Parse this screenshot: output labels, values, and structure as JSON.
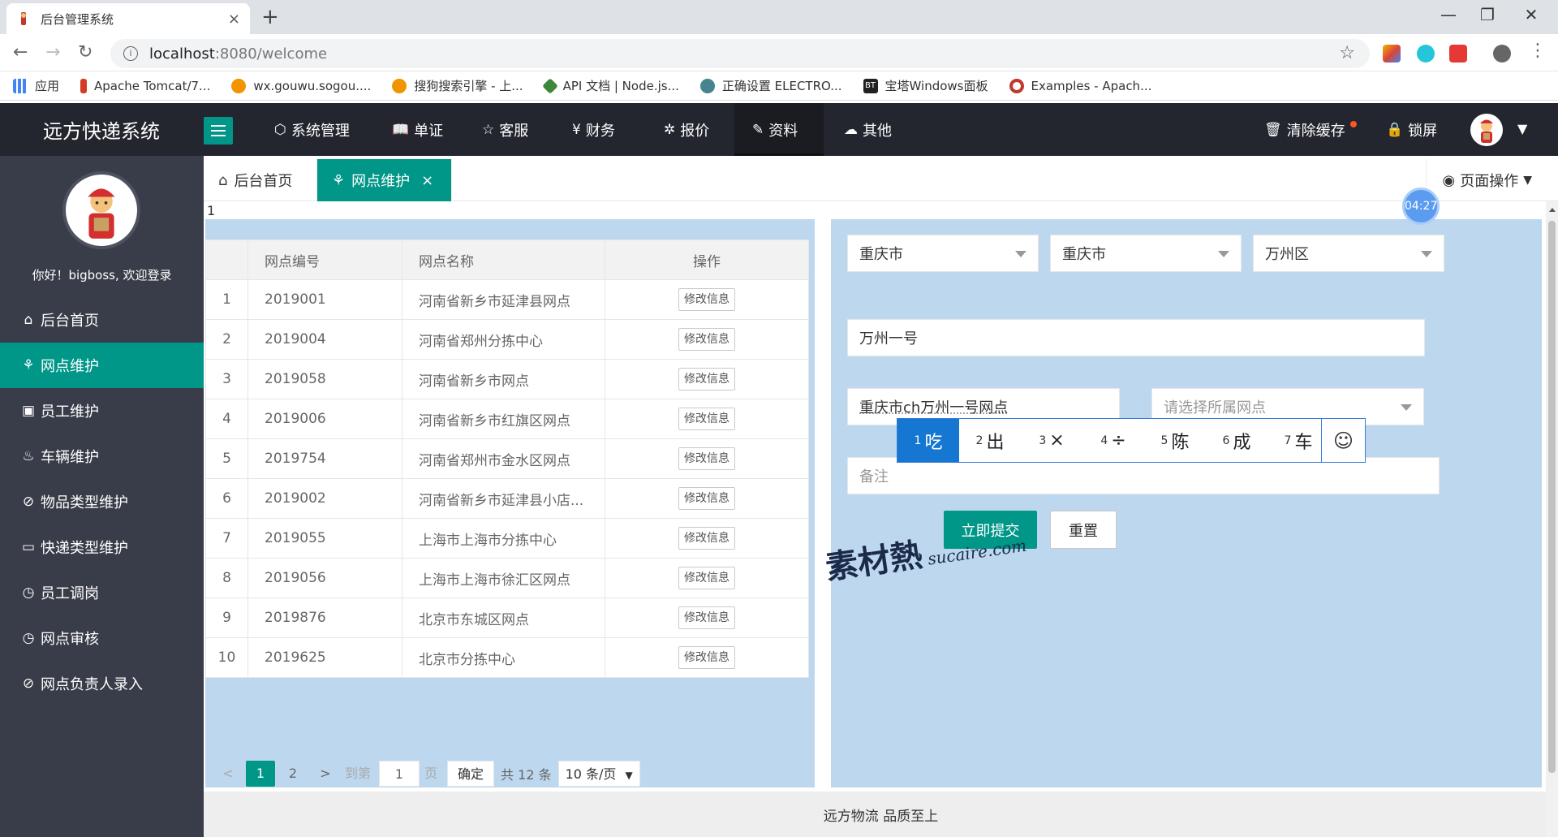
{
  "browser": {
    "tab_title": "后台管理系统",
    "tab_close": "×",
    "new_tab": "+",
    "url_host": "localhost",
    "url_path": ":8080/welcome",
    "window_controls": [
      "—",
      "❐",
      "✕"
    ]
  },
  "bookmarks": [
    {
      "label": "应用",
      "color": "#4285f4"
    },
    {
      "label": "Apache Tomcat/7...",
      "color": "#d33b27"
    },
    {
      "label": "wx.gouwu.sogou....",
      "color": "#f29400"
    },
    {
      "label": "搜狗搜索引擎 - 上...",
      "color": "#f29400"
    },
    {
      "label": "API 文档 | Node.js...",
      "color": "#3c873a"
    },
    {
      "label": "正确设置 ELECTRO...",
      "color": "#47848f"
    },
    {
      "label": "宝塔Windows面板",
      "color": "#222222"
    },
    {
      "label": "Examples - Apach...",
      "color": "#c0392b"
    }
  ],
  "header": {
    "logo": "远方快递系统",
    "nav": [
      {
        "label": "系统管理",
        "icon": "cube-icon"
      },
      {
        "label": "单证",
        "icon": "book-icon"
      },
      {
        "label": "客服",
        "icon": "star-icon"
      },
      {
        "label": "财务",
        "icon": "yen-icon"
      },
      {
        "label": "报价",
        "icon": "fan-icon"
      },
      {
        "label": "资料",
        "icon": "edit-icon"
      },
      {
        "label": "其他",
        "icon": "cloud-upload-icon"
      }
    ],
    "active_nav": "资料",
    "clear_cache": "清除缓存",
    "lock_screen": "锁屏"
  },
  "sidebar": {
    "greeting": "你好！bigboss, 欢迎登录",
    "items": [
      {
        "label": "后台首页",
        "icon": "home-icon"
      },
      {
        "label": "网点维护",
        "icon": "network-icon"
      },
      {
        "label": "员工维护",
        "icon": "id-card-icon"
      },
      {
        "label": "车辆维护",
        "icon": "car-icon"
      },
      {
        "label": "物品类型维护",
        "icon": "code-icon"
      },
      {
        "label": "快递类型维护",
        "icon": "monitor-icon"
      },
      {
        "label": "员工调岗",
        "icon": "clock-icon"
      },
      {
        "label": "网点审核",
        "icon": "clock-icon"
      },
      {
        "label": "网点负责人录入",
        "icon": "code-icon"
      }
    ],
    "active_index": 1
  },
  "tabs": {
    "home": "后台首页",
    "current": "网点维护",
    "close": "×",
    "page_ops": "页面操作",
    "timer": "04:27",
    "frame_number": "1"
  },
  "table": {
    "headers": [
      "",
      "网点编号",
      "网点名称",
      "操作"
    ],
    "edit_label": "修改信息",
    "rows": [
      {
        "idx": "1",
        "code": "2019001",
        "name": "河南省新乡市延津县网点"
      },
      {
        "idx": "2",
        "code": "2019004",
        "name": "河南省郑州分拣中心"
      },
      {
        "idx": "3",
        "code": "2019058",
        "name": "河南省新乡市网点"
      },
      {
        "idx": "4",
        "code": "2019006",
        "name": "河南省新乡市红旗区网点"
      },
      {
        "idx": "5",
        "code": "2019754",
        "name": "河南省郑州市金水区网点"
      },
      {
        "idx": "6",
        "code": "2019002",
        "name": "河南省新乡市延津县小店..."
      },
      {
        "idx": "7",
        "code": "2019055",
        "name": "上海市上海市分拣中心"
      },
      {
        "idx": "8",
        "code": "2019056",
        "name": "上海市上海市徐汇区网点"
      },
      {
        "idx": "9",
        "code": "2019876",
        "name": "北京市东城区网点"
      },
      {
        "idx": "10",
        "code": "2019625",
        "name": "北京市分拣中心"
      }
    ]
  },
  "pager": {
    "prev": "<",
    "pages": [
      "1",
      "2"
    ],
    "current": "1",
    "next": ">",
    "goto_label": "到第",
    "goto_value": "1",
    "page_unit": "页",
    "confirm": "确定",
    "total": "共 12 条",
    "page_size": "10 条/页"
  },
  "form": {
    "province": "重庆市",
    "city": "重庆市",
    "district": "万州区",
    "outlet_name": "万州一号",
    "outlet_fullname": "重庆市ch万州一号网点",
    "parent_outlet_placeholder": "请选择所属网点",
    "remark_placeholder": "备注",
    "submit": "立即提交",
    "reset": "重置"
  },
  "ime": {
    "candidates": [
      {
        "n": "1",
        "text": "吃"
      },
      {
        "n": "2",
        "text": "出"
      },
      {
        "n": "3",
        "text": "×"
      },
      {
        "n": "4",
        "text": "÷"
      },
      {
        "n": "5",
        "text": "陈"
      },
      {
        "n": "6",
        "text": "成"
      },
      {
        "n": "7",
        "text": "车"
      }
    ],
    "emoji": "☺"
  },
  "watermark": {
    "cn": "素材熱",
    "en": "sucaire.com"
  },
  "footer": "远方物流 品质至上",
  "colors": {
    "primary": "#009688",
    "header": "#23262e",
    "sidebar": "#393d49",
    "panel": "#bcd7ee"
  }
}
